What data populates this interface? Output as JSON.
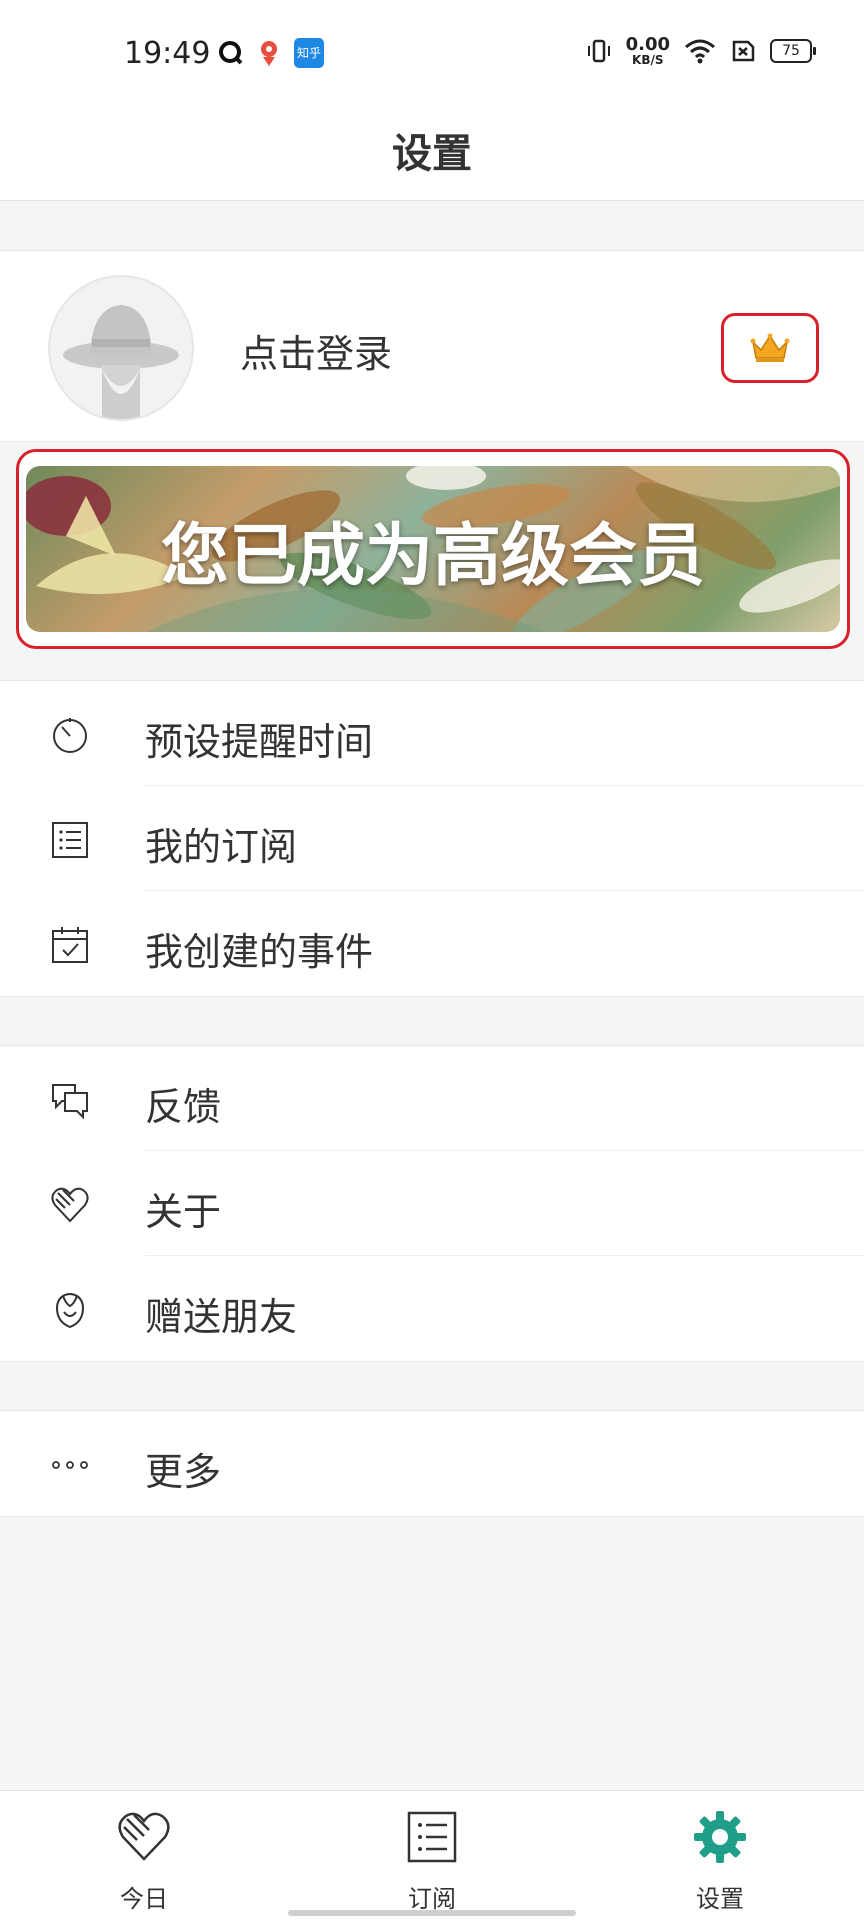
{
  "status_bar": {
    "time": "19:49",
    "net_speed_value": "0.00",
    "net_speed_unit": "KB/S",
    "battery": "75",
    "zhihu_label": "知乎"
  },
  "header": {
    "title": "设置"
  },
  "profile": {
    "login_label": "点击登录",
    "crown_icon": "crown-icon"
  },
  "banner": {
    "text": "您已成为高级会员"
  },
  "menu_group_1": [
    {
      "label": "预设提醒时间",
      "icon": "timer-icon"
    },
    {
      "label": "我的订阅",
      "icon": "list-icon"
    },
    {
      "label": "我创建的事件",
      "icon": "calendar-check-icon"
    }
  ],
  "menu_group_2": [
    {
      "label": "反馈",
      "icon": "chat-bubbles-icon"
    },
    {
      "label": "关于",
      "icon": "heart-icon"
    },
    {
      "label": "赠送朋友",
      "icon": "flower-icon"
    }
  ],
  "menu_group_3": [
    {
      "label": "更多",
      "icon": "more-dots-icon"
    }
  ],
  "bottom_nav": {
    "items": [
      {
        "label": "今日",
        "icon": "heart-icon",
        "active": false
      },
      {
        "label": "订阅",
        "icon": "list-icon",
        "active": false
      },
      {
        "label": "设置",
        "icon": "gear-icon",
        "active": true
      }
    ],
    "active_color": "#1f9e8a"
  },
  "colors": {
    "highlight_border": "#d9212b",
    "crown": "#f5a623"
  }
}
